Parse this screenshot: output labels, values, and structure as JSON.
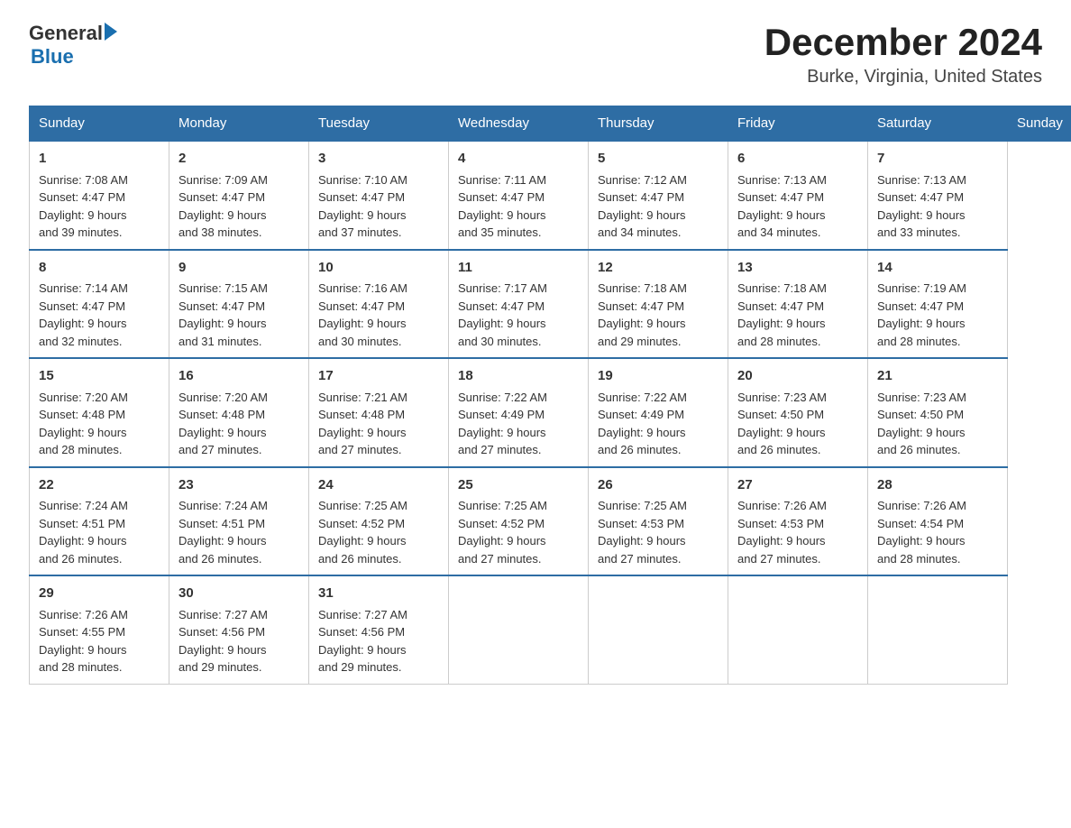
{
  "logo": {
    "general": "General",
    "blue": "Blue"
  },
  "title": {
    "month_year": "December 2024",
    "location": "Burke, Virginia, United States"
  },
  "days_of_week": [
    "Sunday",
    "Monday",
    "Tuesday",
    "Wednesday",
    "Thursday",
    "Friday",
    "Saturday"
  ],
  "weeks": [
    [
      {
        "day": "1",
        "sunrise": "7:08 AM",
        "sunset": "4:47 PM",
        "daylight": "9 hours and 39 minutes."
      },
      {
        "day": "2",
        "sunrise": "7:09 AM",
        "sunset": "4:47 PM",
        "daylight": "9 hours and 38 minutes."
      },
      {
        "day": "3",
        "sunrise": "7:10 AM",
        "sunset": "4:47 PM",
        "daylight": "9 hours and 37 minutes."
      },
      {
        "day": "4",
        "sunrise": "7:11 AM",
        "sunset": "4:47 PM",
        "daylight": "9 hours and 35 minutes."
      },
      {
        "day": "5",
        "sunrise": "7:12 AM",
        "sunset": "4:47 PM",
        "daylight": "9 hours and 34 minutes."
      },
      {
        "day": "6",
        "sunrise": "7:13 AM",
        "sunset": "4:47 PM",
        "daylight": "9 hours and 34 minutes."
      },
      {
        "day": "7",
        "sunrise": "7:13 AM",
        "sunset": "4:47 PM",
        "daylight": "9 hours and 33 minutes."
      }
    ],
    [
      {
        "day": "8",
        "sunrise": "7:14 AM",
        "sunset": "4:47 PM",
        "daylight": "9 hours and 32 minutes."
      },
      {
        "day": "9",
        "sunrise": "7:15 AM",
        "sunset": "4:47 PM",
        "daylight": "9 hours and 31 minutes."
      },
      {
        "day": "10",
        "sunrise": "7:16 AM",
        "sunset": "4:47 PM",
        "daylight": "9 hours and 30 minutes."
      },
      {
        "day": "11",
        "sunrise": "7:17 AM",
        "sunset": "4:47 PM",
        "daylight": "9 hours and 30 minutes."
      },
      {
        "day": "12",
        "sunrise": "7:18 AM",
        "sunset": "4:47 PM",
        "daylight": "9 hours and 29 minutes."
      },
      {
        "day": "13",
        "sunrise": "7:18 AM",
        "sunset": "4:47 PM",
        "daylight": "9 hours and 28 minutes."
      },
      {
        "day": "14",
        "sunrise": "7:19 AM",
        "sunset": "4:47 PM",
        "daylight": "9 hours and 28 minutes."
      }
    ],
    [
      {
        "day": "15",
        "sunrise": "7:20 AM",
        "sunset": "4:48 PM",
        "daylight": "9 hours and 28 minutes."
      },
      {
        "day": "16",
        "sunrise": "7:20 AM",
        "sunset": "4:48 PM",
        "daylight": "9 hours and 27 minutes."
      },
      {
        "day": "17",
        "sunrise": "7:21 AM",
        "sunset": "4:48 PM",
        "daylight": "9 hours and 27 minutes."
      },
      {
        "day": "18",
        "sunrise": "7:22 AM",
        "sunset": "4:49 PM",
        "daylight": "9 hours and 27 minutes."
      },
      {
        "day": "19",
        "sunrise": "7:22 AM",
        "sunset": "4:49 PM",
        "daylight": "9 hours and 26 minutes."
      },
      {
        "day": "20",
        "sunrise": "7:23 AM",
        "sunset": "4:50 PM",
        "daylight": "9 hours and 26 minutes."
      },
      {
        "day": "21",
        "sunrise": "7:23 AM",
        "sunset": "4:50 PM",
        "daylight": "9 hours and 26 minutes."
      }
    ],
    [
      {
        "day": "22",
        "sunrise": "7:24 AM",
        "sunset": "4:51 PM",
        "daylight": "9 hours and 26 minutes."
      },
      {
        "day": "23",
        "sunrise": "7:24 AM",
        "sunset": "4:51 PM",
        "daylight": "9 hours and 26 minutes."
      },
      {
        "day": "24",
        "sunrise": "7:25 AM",
        "sunset": "4:52 PM",
        "daylight": "9 hours and 26 minutes."
      },
      {
        "day": "25",
        "sunrise": "7:25 AM",
        "sunset": "4:52 PM",
        "daylight": "9 hours and 27 minutes."
      },
      {
        "day": "26",
        "sunrise": "7:25 AM",
        "sunset": "4:53 PM",
        "daylight": "9 hours and 27 minutes."
      },
      {
        "day": "27",
        "sunrise": "7:26 AM",
        "sunset": "4:53 PM",
        "daylight": "9 hours and 27 minutes."
      },
      {
        "day": "28",
        "sunrise": "7:26 AM",
        "sunset": "4:54 PM",
        "daylight": "9 hours and 28 minutes."
      }
    ],
    [
      {
        "day": "29",
        "sunrise": "7:26 AM",
        "sunset": "4:55 PM",
        "daylight": "9 hours and 28 minutes."
      },
      {
        "day": "30",
        "sunrise": "7:27 AM",
        "sunset": "4:56 PM",
        "daylight": "9 hours and 29 minutes."
      },
      {
        "day": "31",
        "sunrise": "7:27 AM",
        "sunset": "4:56 PM",
        "daylight": "9 hours and 29 minutes."
      },
      null,
      null,
      null,
      null
    ]
  ],
  "labels": {
    "sunrise": "Sunrise:",
    "sunset": "Sunset:",
    "daylight": "Daylight:"
  }
}
